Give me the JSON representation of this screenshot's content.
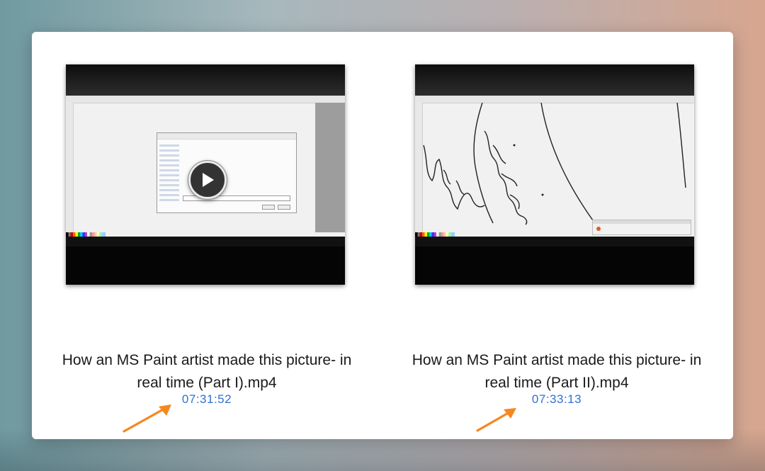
{
  "videos": [
    {
      "title_line1": "How an MS Paint artist made this picture- in",
      "title_line2": "real time (Part I).mp4",
      "duration": "07:31:52"
    },
    {
      "title_line1": "How an MS Paint artist made this picture- in",
      "title_line2": "real time (Part II).mp4",
      "duration": "07:33:13"
    }
  ],
  "icons": {
    "play": "play-icon",
    "annotation": "arrow-icon"
  },
  "colors": {
    "duration_text": "#2f6fd6",
    "arrow": "#f5871f",
    "window_bg": "#ffffff"
  }
}
